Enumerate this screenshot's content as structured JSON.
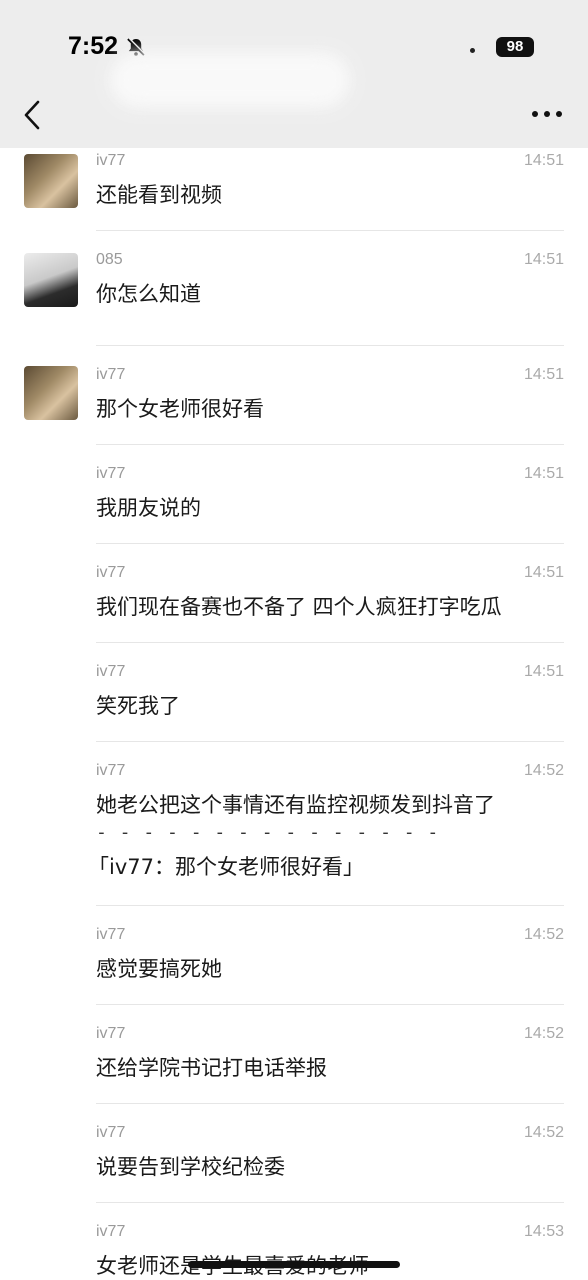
{
  "status_bar": {
    "time": "7:52",
    "battery": "98"
  },
  "messages": [
    {
      "sender": "iv77",
      "time": "14:51",
      "text": "还能看到视频",
      "avatar": "iv77"
    },
    {
      "sender": "085",
      "time": "14:51",
      "text": "你怎么知道",
      "avatar": "085"
    },
    {
      "sender": "iv77",
      "time": "14:51",
      "text": "那个女老师很好看",
      "avatar": "iv77"
    },
    {
      "sender": "iv77",
      "time": "14:51",
      "text": "我朋友说的"
    },
    {
      "sender": "iv77",
      "time": "14:51",
      "text": "我们现在备赛也不备了 四个人疯狂打字吃瓜"
    },
    {
      "sender": "iv77",
      "time": "14:51",
      "text": "笑死我了"
    },
    {
      "sender": "iv77",
      "time": "14:52",
      "text": "她老公把这个事情还有监控视频发到抖音了",
      "quote_sep": "- - - - - - - - - - - - - - -",
      "quote": "「iv77：那个女老师很好看」"
    },
    {
      "sender": "iv77",
      "time": "14:52",
      "text": "感觉要搞死她"
    },
    {
      "sender": "iv77",
      "time": "14:52",
      "text": "还给学院书记打电话举报"
    },
    {
      "sender": "iv77",
      "time": "14:52",
      "text": "说要告到学校纪检委"
    },
    {
      "sender": "iv77",
      "time": "14:53",
      "text": "女老师还是学生最喜爱的老师"
    }
  ]
}
